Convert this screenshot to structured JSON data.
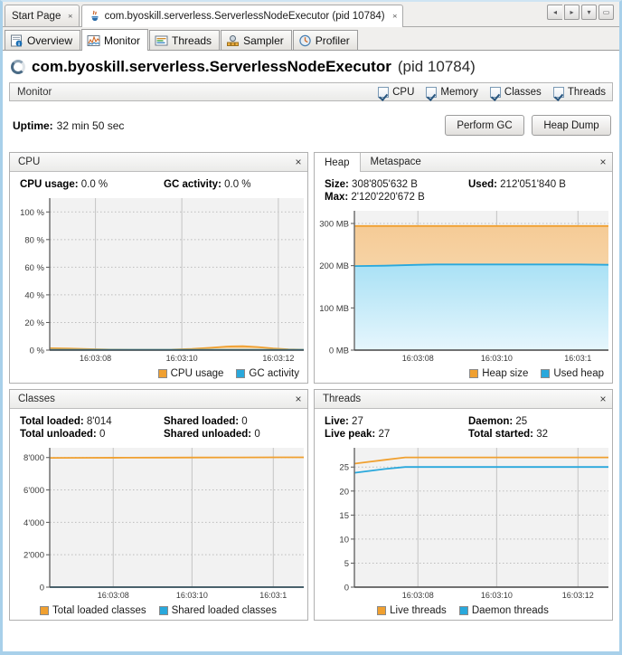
{
  "window": {
    "doc_tabs": [
      {
        "label": "Start Page",
        "icon": "none",
        "close": "×"
      },
      {
        "label": "com.byoskill.serverless.ServerlessNodeExecutor (pid 10784)",
        "icon": "java-coffee-icon",
        "close": "×"
      }
    ],
    "buttons": {
      "scroll_left": "◂",
      "scroll_right": "▸",
      "dropdown": "▾",
      "maximize": "▭"
    }
  },
  "view_tabs": [
    {
      "label": "Overview",
      "icon": "overview-icon"
    },
    {
      "label": "Monitor",
      "icon": "monitor-icon"
    },
    {
      "label": "Threads",
      "icon": "threads-icon"
    },
    {
      "label": "Sampler",
      "icon": "sampler-icon"
    },
    {
      "label": "Profiler",
      "icon": "profiler-icon"
    }
  ],
  "header": {
    "title_main": "com.byoskill.serverless.ServerlessNodeExecutor",
    "title_pid": "(pid 10784)"
  },
  "monitor_bar": {
    "label": "Monitor",
    "checkboxes": [
      {
        "label": "CPU",
        "checked": true
      },
      {
        "label": "Memory",
        "checked": true
      },
      {
        "label": "Classes",
        "checked": true
      },
      {
        "label": "Threads",
        "checked": true
      }
    ]
  },
  "uptime": {
    "label": "Uptime:",
    "value": "32 min 50 sec",
    "perform_gc": "Perform GC",
    "heap_dump": "Heap Dump"
  },
  "colors": {
    "orange_line": "#f0a030",
    "orange_fill": "#f7d3a2",
    "blue_line": "#29a8dc",
    "blue_fill": "#b3e4f6",
    "plot_bg": "#f2f2f2",
    "grid": "#bdbdbd"
  },
  "panels": {
    "cpu": {
      "title": "CPU",
      "close": "×",
      "stats": [
        {
          "label": "CPU usage:",
          "value": "0.0 %"
        },
        {
          "label": "GC activity:",
          "value": "0.0 %"
        }
      ],
      "legend": [
        {
          "label": "CPU usage",
          "color": "#f0a030"
        },
        {
          "label": "GC activity",
          "color": "#29a8dc"
        }
      ]
    },
    "heap": {
      "tabs": [
        {
          "label": "Heap",
          "active": true
        },
        {
          "label": "Metaspace",
          "active": false
        }
      ],
      "close": "×",
      "stats": [
        {
          "label": "Size:",
          "value": "308'805'632 B"
        },
        {
          "label": "Used:",
          "value": "212'051'840 B"
        },
        {
          "label": "Max:",
          "value": "2'120'220'672 B"
        }
      ],
      "legend": [
        {
          "label": "Heap size",
          "color": "#f0a030"
        },
        {
          "label": "Used heap",
          "color": "#29a8dc"
        }
      ]
    },
    "classes": {
      "title": "Classes",
      "close": "×",
      "stats": [
        {
          "label": "Total loaded:",
          "value": "8'014"
        },
        {
          "label": "Shared loaded:",
          "value": "0"
        },
        {
          "label": "Total unloaded:",
          "value": "0"
        },
        {
          "label": "Shared unloaded:",
          "value": "0"
        }
      ],
      "legend": [
        {
          "label": "Total loaded classes",
          "color": "#f0a030"
        },
        {
          "label": "Shared loaded classes",
          "color": "#29a8dc"
        }
      ]
    },
    "threads": {
      "title": "Threads",
      "close": "×",
      "stats": [
        {
          "label": "Live:",
          "value": "27"
        },
        {
          "label": "Daemon:",
          "value": "25"
        },
        {
          "label": "Live peak:",
          "value": "27"
        },
        {
          "label": "Total started:",
          "value": "32"
        }
      ],
      "legend": [
        {
          "label": "Live threads",
          "color": "#f0a030"
        },
        {
          "label": "Daemon threads",
          "color": "#29a8dc"
        }
      ]
    }
  },
  "chart_data": [
    {
      "id": "cpu",
      "type": "area",
      "title": "CPU",
      "xlabel": "",
      "ylabel": "",
      "ylim": [
        0,
        110
      ],
      "yticks": [
        0,
        20,
        40,
        60,
        80,
        100
      ],
      "ytick_labels": [
        "0 %",
        "20 %",
        "40 %",
        "60 %",
        "80 %",
        "100 %"
      ],
      "xticks": [
        0.18,
        0.52,
        0.9
      ],
      "xtick_labels": [
        "16:03:08",
        "16:03:10",
        "16:03:12"
      ],
      "grid": true,
      "legend_position": "bottom-right",
      "x": [
        0,
        0.08,
        0.16,
        0.24,
        0.32,
        0.4,
        0.48,
        0.56,
        0.64,
        0.7,
        0.76,
        0.82,
        0.88,
        0.94,
        1
      ],
      "series": [
        {
          "name": "CPU usage",
          "color": "#f0a030",
          "values": [
            1.4,
            1.1,
            0.7,
            0.4,
            0.3,
            0.3,
            0.4,
            0.9,
            1.8,
            2.6,
            2.8,
            2.2,
            1.2,
            0.5,
            0.3
          ]
        },
        {
          "name": "GC activity",
          "color": "#29a8dc",
          "values": [
            0.2,
            0.2,
            0.2,
            0.2,
            0.2,
            0.2,
            0.2,
            0.2,
            0.2,
            0.2,
            0.2,
            0.2,
            0.2,
            0.2,
            0.2
          ]
        }
      ]
    },
    {
      "id": "heap",
      "type": "area",
      "title": "Heap",
      "xlabel": "",
      "ylabel": "",
      "ylim": [
        0,
        330
      ],
      "yticks": [
        0,
        100,
        200,
        300
      ],
      "ytick_labels": [
        "0 MB",
        "100 MB",
        "200 MB",
        "300 MB"
      ],
      "xticks": [
        0.25,
        0.56,
        0.88
      ],
      "xtick_labels": [
        "16:03:08",
        "16:03:10",
        "16:03:1"
      ],
      "grid": true,
      "legend_position": "bottom-right",
      "x": [
        0,
        0.12,
        0.25,
        0.32,
        0.4,
        0.5,
        0.62,
        0.75,
        0.88,
        1
      ],
      "series": [
        {
          "name": "Heap size",
          "color": "#f0a030",
          "values": [
            294,
            294,
            294,
            294,
            294,
            294,
            294,
            294,
            294,
            294
          ]
        },
        {
          "name": "Used heap",
          "color": "#29a8dc",
          "values": [
            199,
            200,
            202,
            203,
            203,
            203,
            203,
            203,
            203,
            202
          ]
        }
      ]
    },
    {
      "id": "classes",
      "type": "line",
      "title": "Classes",
      "xlabel": "",
      "ylabel": "",
      "ylim": [
        0,
        8600
      ],
      "yticks": [
        0,
        2000,
        4000,
        6000,
        8000
      ],
      "ytick_labels": [
        "0",
        "2'000",
        "4'000",
        "6'000",
        "8'000"
      ],
      "xticks": [
        0.25,
        0.56,
        0.88
      ],
      "xtick_labels": [
        "16:03:08",
        "16:03:10",
        "16:03:1"
      ],
      "grid": true,
      "legend_position": "bottom-center",
      "x": [
        0,
        0.15,
        0.3,
        0.45,
        0.6,
        0.75,
        0.9,
        1
      ],
      "series": [
        {
          "name": "Total loaded classes",
          "color": "#f0a030",
          "values": [
            7980,
            7985,
            7990,
            7996,
            8004,
            8010,
            8014,
            8014
          ]
        },
        {
          "name": "Shared loaded classes",
          "color": "#29a8dc",
          "values": [
            0,
            0,
            0,
            0,
            0,
            0,
            0,
            0
          ]
        }
      ]
    },
    {
      "id": "threads",
      "type": "line",
      "title": "Threads",
      "xlabel": "",
      "ylabel": "",
      "ylim": [
        0,
        29
      ],
      "yticks": [
        0,
        5,
        10,
        15,
        20,
        25
      ],
      "ytick_labels": [
        "0",
        "5",
        "10",
        "15",
        "20",
        "25"
      ],
      "xticks": [
        0.25,
        0.56,
        0.88
      ],
      "xtick_labels": [
        "16:03:08",
        "16:03:10",
        "16:03:12"
      ],
      "grid": true,
      "legend_position": "bottom-center",
      "x": [
        0,
        0.06,
        0.12,
        0.2,
        0.3,
        0.45,
        0.6,
        0.75,
        0.9,
        1
      ],
      "series": [
        {
          "name": "Live threads",
          "color": "#f0a030",
          "values": [
            25.7,
            26.1,
            26.5,
            27,
            27,
            27,
            27,
            27,
            27,
            27
          ]
        },
        {
          "name": "Daemon threads",
          "color": "#29a8dc",
          "values": [
            23.8,
            24.2,
            24.6,
            25,
            25,
            25,
            25,
            25,
            25,
            25
          ]
        }
      ]
    }
  ]
}
